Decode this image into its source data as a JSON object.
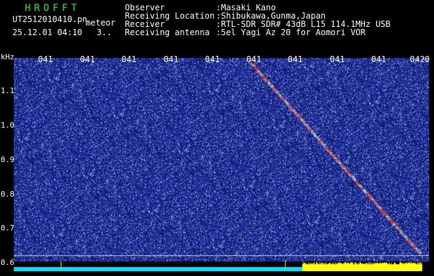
{
  "header": {
    "app_title": "HROFFT",
    "file_name": "UT2512010410.pn",
    "detect_type": "meteor",
    "date_time": "25.12.01 04:10",
    "count": "3..",
    "observer_label": "Observer",
    "observer_value": ":Masaki Kano",
    "location_label": "Receiving Location",
    "location_value": ":Shibukawa,Gunma,Japan",
    "receiver_label": "Receiver",
    "receiver_value": ":RTL-SDR SDR# 43dB L15 114.1MHz USB",
    "antenna_label": "Receiving antenna",
    "antenna_value": ":5el Yagi Az 20 for Aomori VOR"
  },
  "time_axis": {
    "ticks": [
      "041",
      "041",
      "041",
      "041",
      "041",
      "041",
      "041",
      "041",
      "041",
      "0420"
    ]
  },
  "freq_axis": {
    "unit": "kHz",
    "ticks": [
      "1.1",
      "1.0",
      "0.9",
      "0.8",
      "0.7",
      "0.6"
    ]
  },
  "colors": {
    "background": "#000000",
    "noise_base": "#1a2a8a",
    "trace": "#e03020",
    "signal_bar": "#ffff00",
    "noise_bar": "#00e0ff",
    "title_green": "#22ee22"
  }
}
